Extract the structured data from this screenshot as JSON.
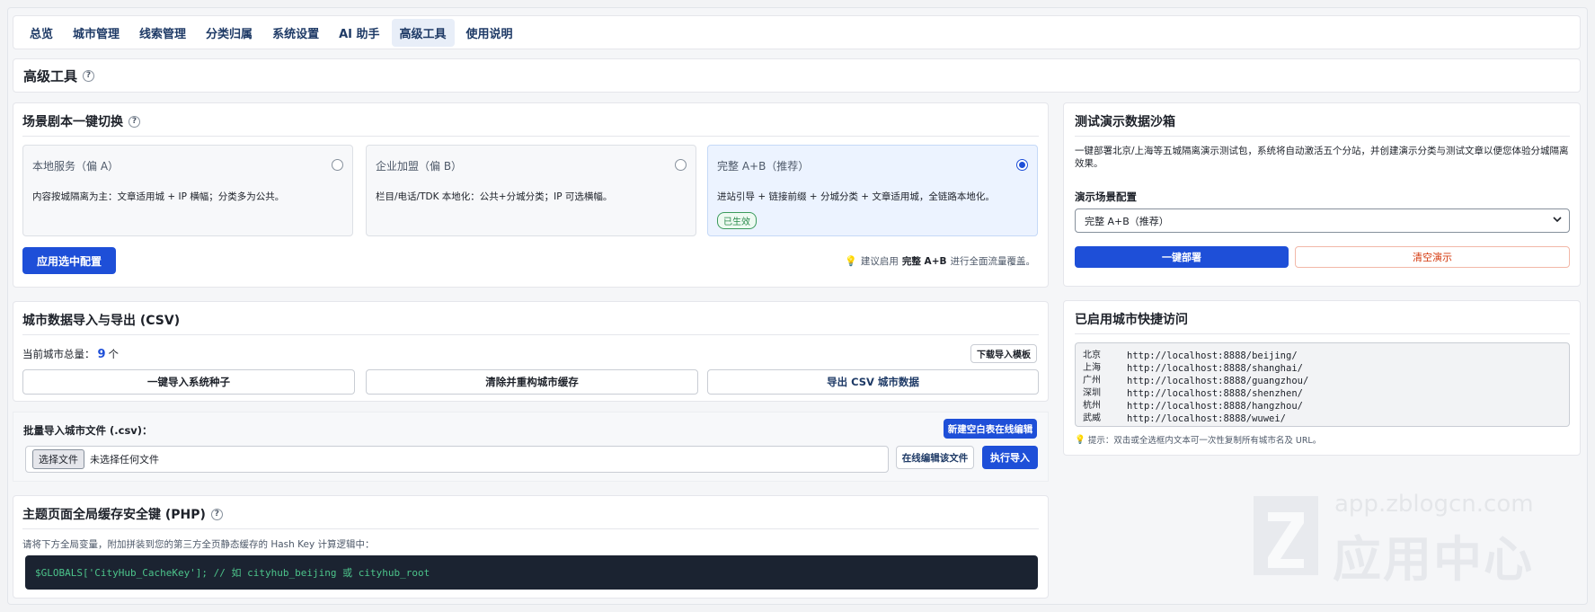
{
  "nav": {
    "items": [
      {
        "label": "总览"
      },
      {
        "label": "城市管理"
      },
      {
        "label": "线索管理"
      },
      {
        "label": "分类归属"
      },
      {
        "label": "系统设置"
      },
      {
        "label": "AI 助手"
      },
      {
        "label": "高级工具",
        "active": true
      },
      {
        "label": "使用说明"
      }
    ]
  },
  "page_title": "高级工具",
  "help_glyph": "?",
  "scene": {
    "title": "场景剧本一键切换",
    "options": [
      {
        "name": "本地服务（偏 A）",
        "desc": "内容按城隔离为主：文章适用城 + IP 横幅；分类多为公共。",
        "selected": false
      },
      {
        "name": "企业加盟（偏 B）",
        "desc": "栏目/电话/TDK 本地化：公共+分城分类；IP 可选横幅。",
        "selected": false
      },
      {
        "name": "完整 A+B（推荐）",
        "desc": "进站引导 + 链接前缀 + 分城分类 + 文章适用城，全链路本地化。",
        "selected": true,
        "badge": "已生效"
      }
    ],
    "apply_button": "应用选中配置",
    "tip_icon": "lightbulb-icon",
    "tip_prefix": "建议启用",
    "tip_strong": "完整 A+B",
    "tip_suffix": "进行全面流量覆盖。"
  },
  "city": {
    "title": "城市数据导入与导出 (CSV)",
    "total_label": "当前城市总量：",
    "total_value": "9",
    "total_unit": "个",
    "download_template": "下载导入模板",
    "btn_import_seed": "一键导入系统种子",
    "btn_clear_cache": "清除并重构城市缓存",
    "btn_export": "导出 CSV 城市数据",
    "batch_label": "批量导入城市文件 (.csv)：",
    "new_blank": "新建空白表在线编辑",
    "file_button": "选择文件",
    "file_status": "未选择任何文件",
    "edit_file": "在线编辑该文件",
    "run_import": "执行导入"
  },
  "php": {
    "title": "主题页面全局缓存安全键 (PHP)",
    "desc": "请将下方全局变量，附加拼装到您的第三方全页静态缓存的 Hash Key 计算逻辑中：",
    "code": "$GLOBALS['CityHub_CacheKey']; // 如 cityhub_beijing 或 cityhub_root"
  },
  "sandbox": {
    "title": "测试演示数据沙箱",
    "desc": "一键部署北京/上海等五城隔离演示测试包，系统将自动激活五个分站，并创建演示分类与测试文章以便您体验分城隔离效果。",
    "config_label": "演示场景配置",
    "select_value": "完整 A+B（推荐）",
    "deploy_button": "一键部署",
    "clear_button": "清空演示"
  },
  "quick": {
    "title": "已启用城市快捷访问",
    "rows": [
      {
        "city": "北京",
        "url": "http://localhost:8888/beijing/"
      },
      {
        "city": "上海",
        "url": "http://localhost:8888/shanghai/"
      },
      {
        "city": "广州",
        "url": "http://localhost:8888/guangzhou/"
      },
      {
        "city": "深圳",
        "url": "http://localhost:8888/shenzhen/"
      },
      {
        "city": "杭州",
        "url": "http://localhost:8888/hangzhou/"
      },
      {
        "city": "武威",
        "url": "http://localhost:8888/wuwei/"
      }
    ],
    "hint": "提示：双击或全选框内文本可一次性复制所有城市名及 URL。"
  },
  "watermark": {
    "domain": "app.zblogcn.com",
    "text": "应用中心"
  },
  "colors": {
    "primary": "#1e4fd8",
    "danger": "#d4380d",
    "success": "#2a8a4c"
  }
}
